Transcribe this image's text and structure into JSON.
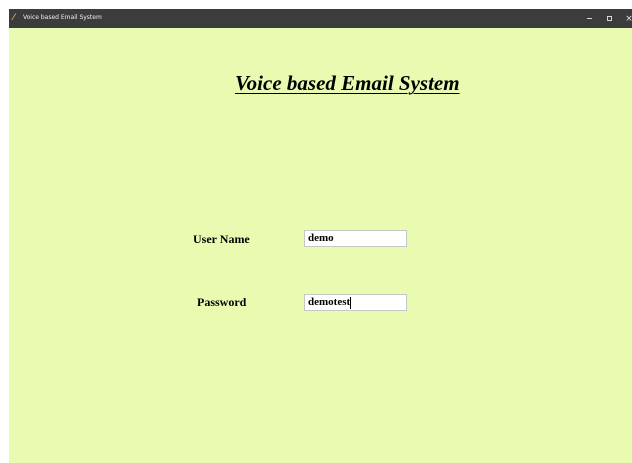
{
  "window": {
    "title": "Voice based Email System",
    "icon": "feather-icon",
    "controls": {
      "minimize": "minimize-icon",
      "maximize": "maximize-icon",
      "close": "×"
    }
  },
  "heading": "Voice based Email System",
  "form": {
    "username": {
      "label": "User Name",
      "value": "demo"
    },
    "password": {
      "label": "Password",
      "value": "demotest"
    }
  },
  "colors": {
    "background": "#e9fbb0",
    "titlebar": "#3c3c3c"
  }
}
